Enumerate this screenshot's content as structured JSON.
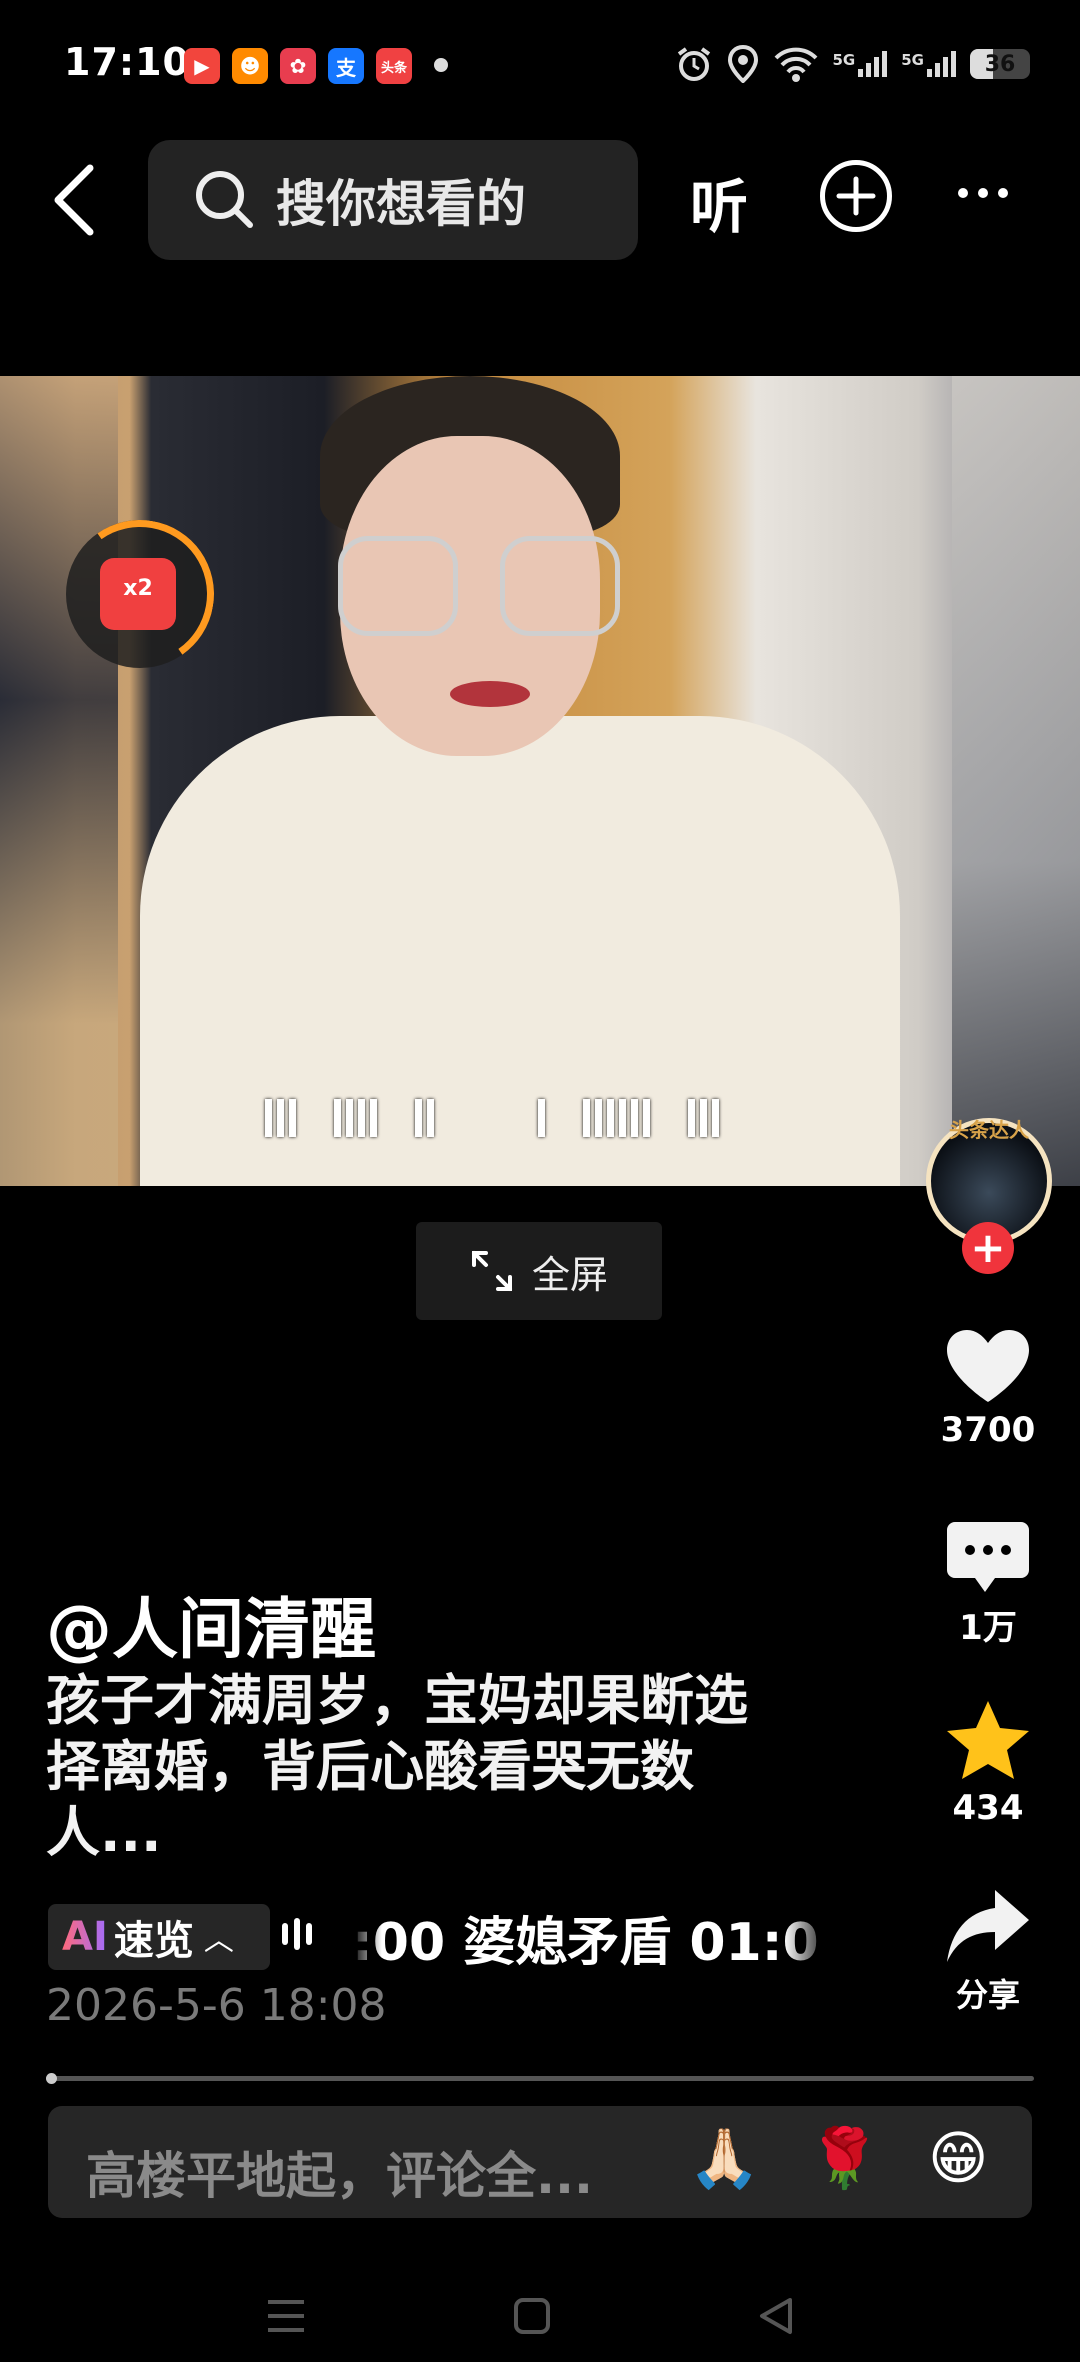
{
  "status_bar": {
    "time": "17:10",
    "notifications": [
      {
        "icon": "video-app-icon",
        "color": "#f2453d",
        "glyph": "▶"
      },
      {
        "icon": "shop-app-icon",
        "color": "#ff8a00",
        "glyph": "☻"
      },
      {
        "icon": "game-app-icon",
        "color": "#e83d4f",
        "glyph": "✿"
      },
      {
        "icon": "alipay-icon",
        "color": "#1677ff",
        "glyph": "支"
      },
      {
        "icon": "toutiao-icon",
        "color": "#f04142",
        "glyph": "头条"
      }
    ],
    "network_1": "5G",
    "network_2": "5G",
    "battery": "36"
  },
  "top_bar": {
    "search_placeholder": "搜你想看的",
    "listen_label": "听"
  },
  "video": {
    "redpacket_label": "x2",
    "redpacket_progress": 0.3,
    "fullscreen_label": "全屏"
  },
  "avatar": {
    "badge_text": "头条达人"
  },
  "actions": {
    "likes": "3700",
    "comments": "1万",
    "favorites": "434",
    "share_label": "分享"
  },
  "post": {
    "author": "@人间清醒",
    "caption_line1": "孩子才满周岁，宝妈却果断选",
    "caption_line2": "择离婚，背后心酸看哭无数",
    "caption_line3": "人...",
    "ai_prefix": "AI",
    "ai_label": "速览",
    "chapter_text": ":00 婆媳矛盾   01:0",
    "timestamp": "2026-5-6 18:08"
  },
  "comment_bar": {
    "placeholder": "高楼平地起，评论全...",
    "emojis": [
      "🙏🏻",
      "🌹",
      "😁"
    ]
  },
  "colors": {
    "background": "#000000",
    "accent_red": "#f0343c",
    "favorite_yellow": "#ffc21a",
    "redpacket_ring": "#ff9a1f"
  }
}
